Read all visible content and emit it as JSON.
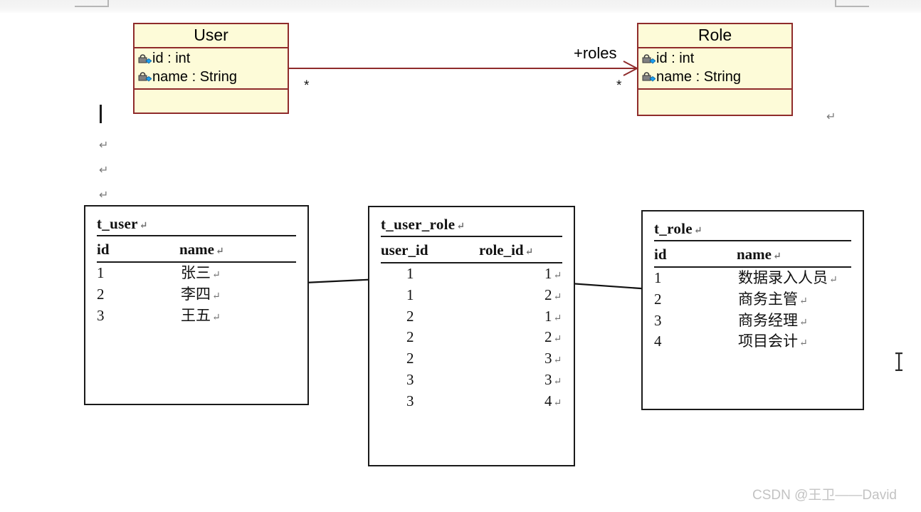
{
  "document": {
    "watermark": "CSDN @王卫——David",
    "margin_marks": [
      "top-left-margin-corner",
      "top-right-margin-corner"
    ],
    "editing_marks": {
      "caret": "|",
      "paragraph_return": "↵",
      "return_count_left": 3,
      "return_count_right": 1
    },
    "mouse_cursor": "i-beam-cursor"
  },
  "uml": {
    "classes": [
      {
        "name": "User",
        "attributes": [
          {
            "icon": "private-attribute-icon",
            "text": "id : int"
          },
          {
            "icon": "private-attribute-icon",
            "text": "name : String"
          }
        ],
        "operations": []
      },
      {
        "name": "Role",
        "attributes": [
          {
            "icon": "private-attribute-icon",
            "text": "id : int"
          },
          {
            "icon": "private-attribute-icon",
            "text": "name : String"
          }
        ],
        "operations": []
      }
    ],
    "association": {
      "label": "+roles",
      "source_multiplicity": "*",
      "target_multiplicity": "*",
      "direction": "User -> Role",
      "line_color": "#8f2b2b"
    },
    "colors": {
      "fill": "#fdfbd8",
      "border": "#8f2b2b"
    }
  },
  "tables": [
    {
      "id": "t_user",
      "name": "t_user",
      "columns": [
        "id",
        "name"
      ],
      "rows": [
        [
          "1",
          "张三"
        ],
        [
          "2",
          "李四"
        ],
        [
          "3",
          "王五"
        ]
      ]
    },
    {
      "id": "t_user_role",
      "name": "t_user_role",
      "columns": [
        "user_id",
        "role_id"
      ],
      "rows": [
        [
          "1",
          "1"
        ],
        [
          "1",
          "2"
        ],
        [
          "2",
          "1"
        ],
        [
          "2",
          "2"
        ],
        [
          "2",
          "3"
        ],
        [
          "3",
          "3"
        ],
        [
          "3",
          "4"
        ]
      ]
    },
    {
      "id": "t_role",
      "name": "t_role",
      "columns": [
        "id",
        "name"
      ],
      "rows": [
        [
          "1",
          "数据录入人员"
        ],
        [
          "2",
          "商务主管"
        ],
        [
          "3",
          "商务经理"
        ],
        [
          "4",
          "项目会计"
        ]
      ]
    }
  ],
  "mapping_arrows": [
    {
      "from": "t_user_role.user_id=1",
      "to": "t_user.id=1",
      "direction": "left"
    },
    {
      "from": "t_user_role.role_id=1",
      "to": "t_role.id=1",
      "direction": "right"
    }
  ]
}
